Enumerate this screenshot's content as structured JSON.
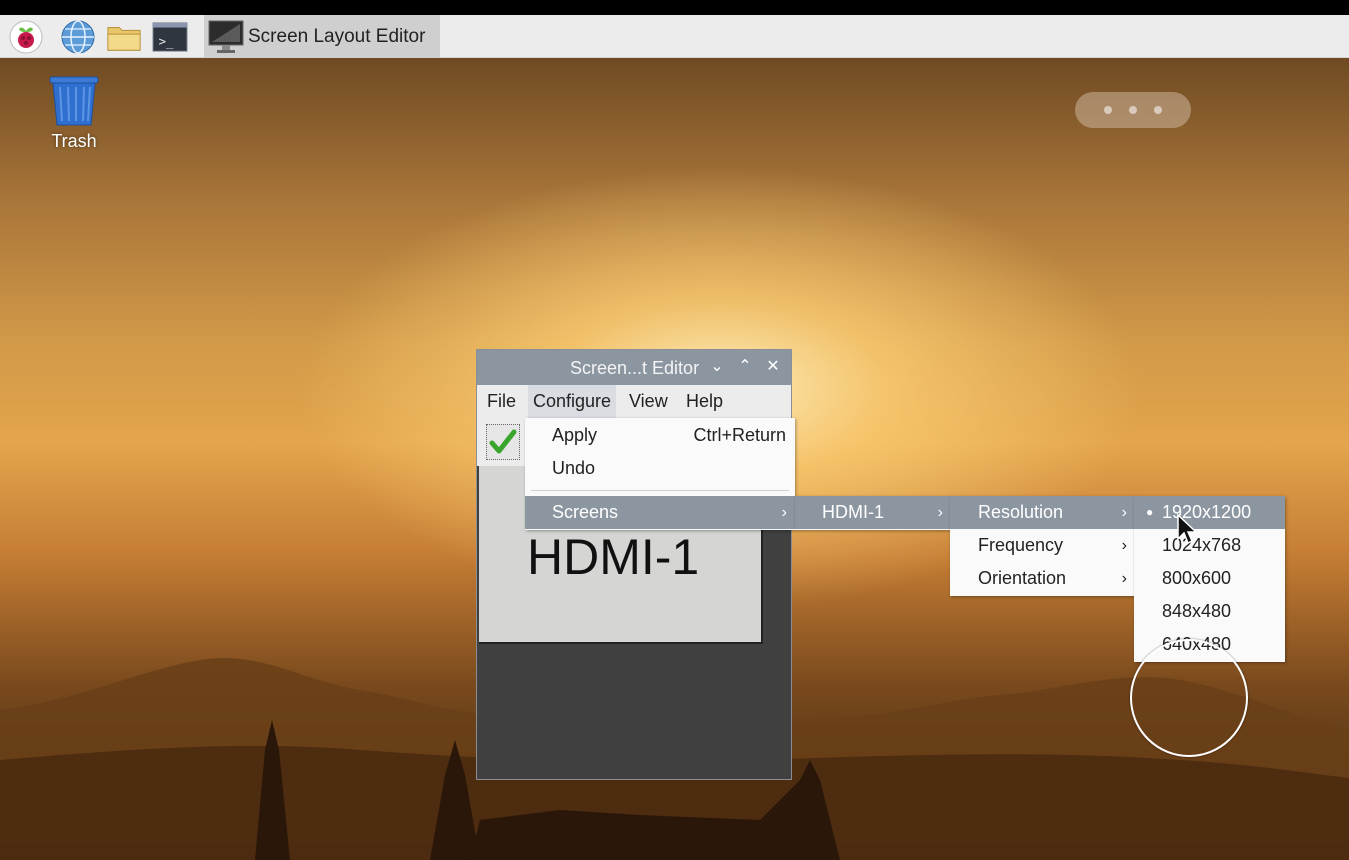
{
  "taskbar": {
    "icons": [
      "raspberry-menu-icon",
      "web-browser-icon",
      "file-manager-icon",
      "terminal-icon"
    ],
    "task_button_label": "Screen Layout Editor"
  },
  "desktop": {
    "trash_label": "Trash"
  },
  "window": {
    "title": "Screen...t Editor",
    "buttons": [
      "minimize-icon",
      "maximize-icon",
      "close-icon"
    ],
    "menubar": [
      "File",
      "Configure",
      "View",
      "Help"
    ],
    "active_menu": "Configure",
    "monitor_label": "HDMI-1"
  },
  "configure_menu": {
    "items": [
      {
        "label": "Apply",
        "shortcut": "Ctrl+Return"
      },
      {
        "label": "Undo",
        "shortcut": ""
      },
      {
        "label": "Screens",
        "has_submenu": true,
        "highlighted": true
      }
    ]
  },
  "screens_menu": {
    "items": [
      {
        "label": "HDMI-1",
        "has_submenu": true,
        "highlighted": true
      }
    ]
  },
  "hdmi_menu": {
    "items": [
      {
        "label": "Resolution",
        "has_submenu": true,
        "highlighted": true
      },
      {
        "label": "Frequency",
        "has_submenu": true
      },
      {
        "label": "Orientation",
        "has_submenu": true
      }
    ]
  },
  "resolution_menu": {
    "items": [
      {
        "label": "1920x1200",
        "selected": true,
        "highlighted": true
      },
      {
        "label": "1024x768"
      },
      {
        "label": "800x600"
      },
      {
        "label": "848x480"
      },
      {
        "label": "640x480"
      }
    ]
  },
  "colors": {
    "menu_highlight": "#8c96a0",
    "titlebar": "#8c96a0",
    "taskbar": "#ececec"
  }
}
